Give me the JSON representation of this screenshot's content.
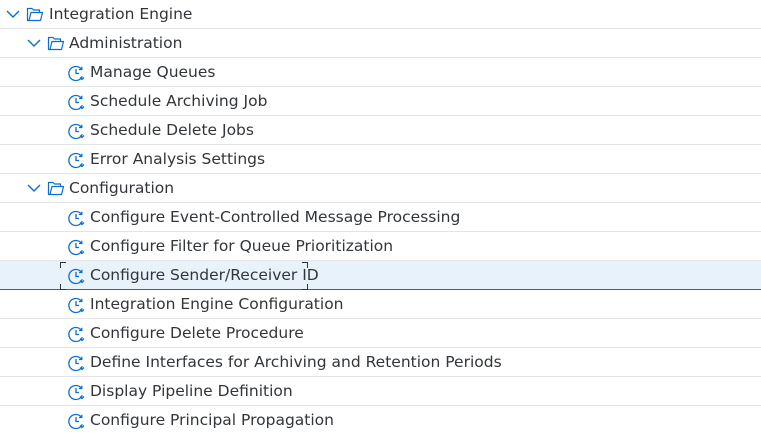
{
  "tree": {
    "root": {
      "label": "Integration Engine",
      "icon": "folder-open-icon",
      "expanded": true
    },
    "administration": {
      "label": "Administration",
      "icon": "folder-open-icon",
      "expanded": true,
      "items": [
        {
          "label": "Manage Queues",
          "icon": "transaction-icon"
        },
        {
          "label": "Schedule Archiving Job",
          "icon": "transaction-icon"
        },
        {
          "label": "Schedule Delete Jobs",
          "icon": "transaction-icon"
        },
        {
          "label": "Error Analysis Settings",
          "icon": "transaction-icon"
        }
      ]
    },
    "configuration": {
      "label": "Configuration",
      "icon": "folder-open-icon",
      "expanded": true,
      "items": [
        {
          "label": "Configure Event-Controlled Message Processing",
          "icon": "transaction-icon"
        },
        {
          "label": "Configure Filter for Queue Prioritization",
          "icon": "transaction-icon"
        },
        {
          "label": "Configure Sender/Receiver ID",
          "icon": "transaction-icon",
          "selected": true
        },
        {
          "label": "Integration Engine Configuration",
          "icon": "transaction-icon"
        },
        {
          "label": "Configure Delete Procedure",
          "icon": "transaction-icon"
        },
        {
          "label": "Define Interfaces for Archiving and Retention Periods",
          "icon": "transaction-icon"
        },
        {
          "label": "Display Pipeline Definition",
          "icon": "transaction-icon"
        },
        {
          "label": "Configure Principal Propagation",
          "icon": "transaction-icon"
        }
      ]
    }
  },
  "colors": {
    "icon": "#0a6ed1",
    "text": "#32363a",
    "selected_bg": "#e8f2fb",
    "selected_line": "#0a6ed1",
    "separator": "#e5e5e5"
  }
}
